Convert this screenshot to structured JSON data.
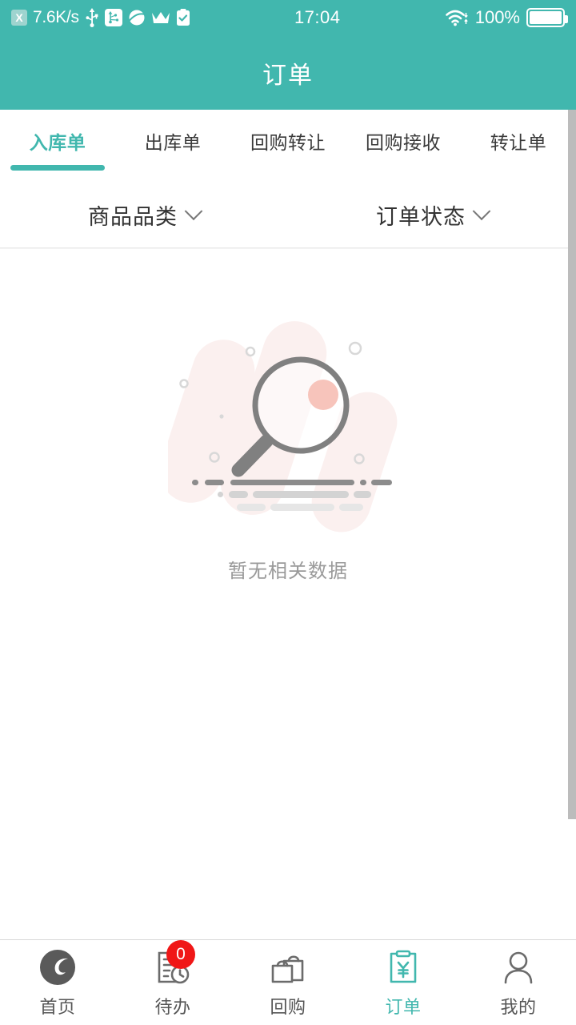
{
  "statusbar": {
    "net_badge": "X",
    "speed": "7.6K/s",
    "icons": [
      "usb-icon",
      "usb-debug-icon",
      "planet-icon",
      "crown-icon",
      "clipboard-check-icon"
    ],
    "time": "17:04",
    "wifi_icon": "wifi-icon",
    "battery_percent": "100%",
    "battery_icon": "battery-full-icon"
  },
  "header": {
    "title": "订单"
  },
  "tabs": [
    {
      "label": "入库单",
      "active": true
    },
    {
      "label": "出库单",
      "active": false
    },
    {
      "label": "回购转让",
      "active": false
    },
    {
      "label": "回购接收",
      "active": false
    },
    {
      "label": "转让单",
      "active": false
    }
  ],
  "filters": [
    {
      "label": "商品品类",
      "icon": "chevron-down-icon"
    },
    {
      "label": "订单状态",
      "icon": "chevron-down-icon"
    }
  ],
  "empty_state": {
    "illustration": "magnifier-no-data-illustration",
    "message": "暂无相关数据"
  },
  "bottom_nav": [
    {
      "label": "首页",
      "icon": "logo-e-icon",
      "active": false,
      "badge": null
    },
    {
      "label": "待办",
      "icon": "doc-clock-icon",
      "active": false,
      "badge": "0"
    },
    {
      "label": "回购",
      "icon": "shopping-bags-icon",
      "active": false,
      "badge": null
    },
    {
      "label": "订单",
      "icon": "clipboard-yen-icon",
      "active": true,
      "badge": null
    },
    {
      "label": "我的",
      "icon": "person-icon",
      "active": false,
      "badge": null
    }
  ],
  "colors": {
    "accent": "#41b7ae",
    "badge_red": "#f01717",
    "text_primary": "#333333",
    "text_muted": "#9a9a9a"
  }
}
